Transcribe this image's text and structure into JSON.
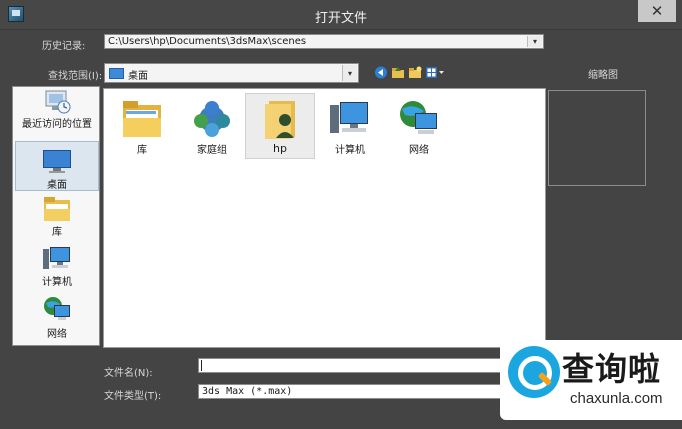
{
  "window": {
    "title": "打开文件",
    "close_glyph": "✕"
  },
  "history": {
    "label": "历史记录:",
    "value": "C:\\Users\\hp\\Documents\\3dsMax\\scenes"
  },
  "lookin": {
    "label": "查找范围(I):",
    "value": "桌面"
  },
  "toolbar": {
    "icons": [
      "back-icon",
      "up-folder-icon",
      "new-folder-icon",
      "view-menu-icon"
    ]
  },
  "sidebar": {
    "items": [
      {
        "label": "最近访问的位置",
        "icon": "recent-places-icon"
      },
      {
        "label": "桌面",
        "icon": "desktop-icon",
        "selected": true
      },
      {
        "label": "库",
        "icon": "libraries-icon"
      },
      {
        "label": "计算机",
        "icon": "computer-icon"
      },
      {
        "label": "网络",
        "icon": "network-icon"
      }
    ]
  },
  "files": [
    {
      "label": "库",
      "icon": "libraries-icon"
    },
    {
      "label": "家庭组",
      "icon": "homegroup-icon"
    },
    {
      "label": "hp",
      "icon": "user-folder-icon",
      "selected": true
    },
    {
      "label": "计算机",
      "icon": "computer-icon"
    },
    {
      "label": "网络",
      "icon": "network-icon"
    }
  ],
  "preview": {
    "label": "缩略图"
  },
  "filename": {
    "label": "文件名(N):",
    "value": ""
  },
  "filetype": {
    "label": "文件类型(T):",
    "value": "3ds Max (*.max)"
  },
  "watermark": {
    "brand_cn": "查询啦",
    "brand_url": "chaxunla.com"
  },
  "colors": {
    "dialog_bg": "#444444",
    "pane_bg": "#ffffff",
    "selection": "#dbe6ef",
    "watermark_blue": "#1ba6e0",
    "watermark_orange": "#f3a21a"
  }
}
